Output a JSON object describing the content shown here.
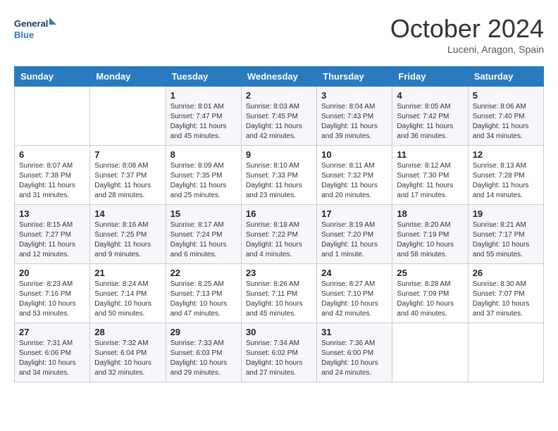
{
  "logo": {
    "text_general": "General",
    "text_blue": "Blue"
  },
  "header": {
    "month": "October 2024",
    "location": "Luceni, Aragon, Spain"
  },
  "weekdays": [
    "Sunday",
    "Monday",
    "Tuesday",
    "Wednesday",
    "Thursday",
    "Friday",
    "Saturday"
  ],
  "weeks": [
    [
      {
        "day": "",
        "text": ""
      },
      {
        "day": "",
        "text": ""
      },
      {
        "day": "1",
        "text": "Sunrise: 8:01 AM\nSunset: 7:47 PM\nDaylight: 11 hours and 45 minutes."
      },
      {
        "day": "2",
        "text": "Sunrise: 8:03 AM\nSunset: 7:45 PM\nDaylight: 11 hours and 42 minutes."
      },
      {
        "day": "3",
        "text": "Sunrise: 8:04 AM\nSunset: 7:43 PM\nDaylight: 11 hours and 39 minutes."
      },
      {
        "day": "4",
        "text": "Sunrise: 8:05 AM\nSunset: 7:42 PM\nDaylight: 11 hours and 36 minutes."
      },
      {
        "day": "5",
        "text": "Sunrise: 8:06 AM\nSunset: 7:40 PM\nDaylight: 11 hours and 34 minutes."
      }
    ],
    [
      {
        "day": "6",
        "text": "Sunrise: 8:07 AM\nSunset: 7:38 PM\nDaylight: 11 hours and 31 minutes."
      },
      {
        "day": "7",
        "text": "Sunrise: 8:08 AM\nSunset: 7:37 PM\nDaylight: 11 hours and 28 minutes."
      },
      {
        "day": "8",
        "text": "Sunrise: 8:09 AM\nSunset: 7:35 PM\nDaylight: 11 hours and 25 minutes."
      },
      {
        "day": "9",
        "text": "Sunrise: 8:10 AM\nSunset: 7:33 PM\nDaylight: 11 hours and 23 minutes."
      },
      {
        "day": "10",
        "text": "Sunrise: 8:11 AM\nSunset: 7:32 PM\nDaylight: 11 hours and 20 minutes."
      },
      {
        "day": "11",
        "text": "Sunrise: 8:12 AM\nSunset: 7:30 PM\nDaylight: 11 hours and 17 minutes."
      },
      {
        "day": "12",
        "text": "Sunrise: 8:13 AM\nSunset: 7:28 PM\nDaylight: 11 hours and 14 minutes."
      }
    ],
    [
      {
        "day": "13",
        "text": "Sunrise: 8:15 AM\nSunset: 7:27 PM\nDaylight: 11 hours and 12 minutes."
      },
      {
        "day": "14",
        "text": "Sunrise: 8:16 AM\nSunset: 7:25 PM\nDaylight: 11 hours and 9 minutes."
      },
      {
        "day": "15",
        "text": "Sunrise: 8:17 AM\nSunset: 7:24 PM\nDaylight: 11 hours and 6 minutes."
      },
      {
        "day": "16",
        "text": "Sunrise: 8:18 AM\nSunset: 7:22 PM\nDaylight: 11 hours and 4 minutes."
      },
      {
        "day": "17",
        "text": "Sunrise: 8:19 AM\nSunset: 7:20 PM\nDaylight: 11 hours and 1 minute."
      },
      {
        "day": "18",
        "text": "Sunrise: 8:20 AM\nSunset: 7:19 PM\nDaylight: 10 hours and 58 minutes."
      },
      {
        "day": "19",
        "text": "Sunrise: 8:21 AM\nSunset: 7:17 PM\nDaylight: 10 hours and 55 minutes."
      }
    ],
    [
      {
        "day": "20",
        "text": "Sunrise: 8:23 AM\nSunset: 7:16 PM\nDaylight: 10 hours and 53 minutes."
      },
      {
        "day": "21",
        "text": "Sunrise: 8:24 AM\nSunset: 7:14 PM\nDaylight: 10 hours and 50 minutes."
      },
      {
        "day": "22",
        "text": "Sunrise: 8:25 AM\nSunset: 7:13 PM\nDaylight: 10 hours and 47 minutes."
      },
      {
        "day": "23",
        "text": "Sunrise: 8:26 AM\nSunset: 7:11 PM\nDaylight: 10 hours and 45 minutes."
      },
      {
        "day": "24",
        "text": "Sunrise: 8:27 AM\nSunset: 7:10 PM\nDaylight: 10 hours and 42 minutes."
      },
      {
        "day": "25",
        "text": "Sunrise: 8:28 AM\nSunset: 7:09 PM\nDaylight: 10 hours and 40 minutes."
      },
      {
        "day": "26",
        "text": "Sunrise: 8:30 AM\nSunset: 7:07 PM\nDaylight: 10 hours and 37 minutes."
      }
    ],
    [
      {
        "day": "27",
        "text": "Sunrise: 7:31 AM\nSunset: 6:06 PM\nDaylight: 10 hours and 34 minutes."
      },
      {
        "day": "28",
        "text": "Sunrise: 7:32 AM\nSunset: 6:04 PM\nDaylight: 10 hours and 32 minutes."
      },
      {
        "day": "29",
        "text": "Sunrise: 7:33 AM\nSunset: 6:03 PM\nDaylight: 10 hours and 29 minutes."
      },
      {
        "day": "30",
        "text": "Sunrise: 7:34 AM\nSunset: 6:02 PM\nDaylight: 10 hours and 27 minutes."
      },
      {
        "day": "31",
        "text": "Sunrise: 7:36 AM\nSunset: 6:00 PM\nDaylight: 10 hours and 24 minutes."
      },
      {
        "day": "",
        "text": ""
      },
      {
        "day": "",
        "text": ""
      }
    ]
  ]
}
